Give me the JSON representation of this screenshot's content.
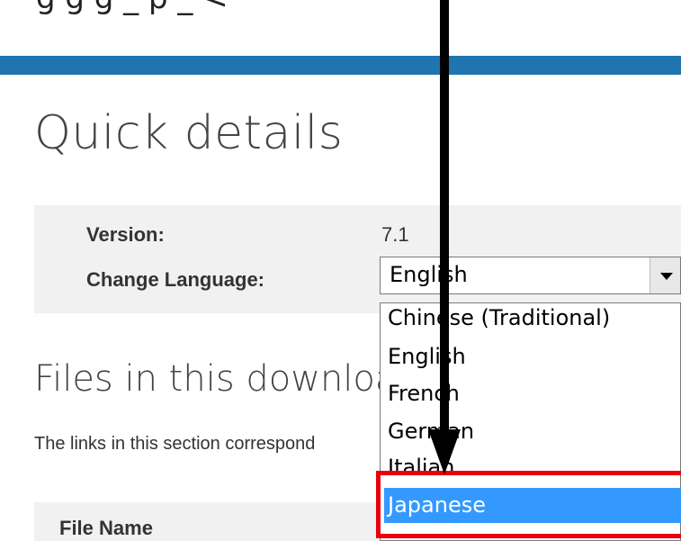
{
  "top_text": "g     g   g   _     p       _     <",
  "page": {
    "title": "Quick details"
  },
  "details": {
    "version_label": "Version:",
    "version_value": "7.1",
    "language_label": "Change Language:"
  },
  "language_select": {
    "selected": "English",
    "options": [
      "Chinese (Traditional)",
      "English",
      "French",
      "German",
      "Italian",
      "Japanese"
    ],
    "highlighted": "Japanese"
  },
  "files_section": {
    "title": "Files in this download",
    "description": "The links in this section correspond",
    "column_file_name": "File Name"
  },
  "colors": {
    "accent_bar": "#1f75b0",
    "option_highlight": "#3399ff",
    "annotation_box": "#e8000b",
    "annotation_arrow": "#000000"
  },
  "icons": [
    "dropdown-arrow-icon",
    "annotation-arrow-icon"
  ]
}
